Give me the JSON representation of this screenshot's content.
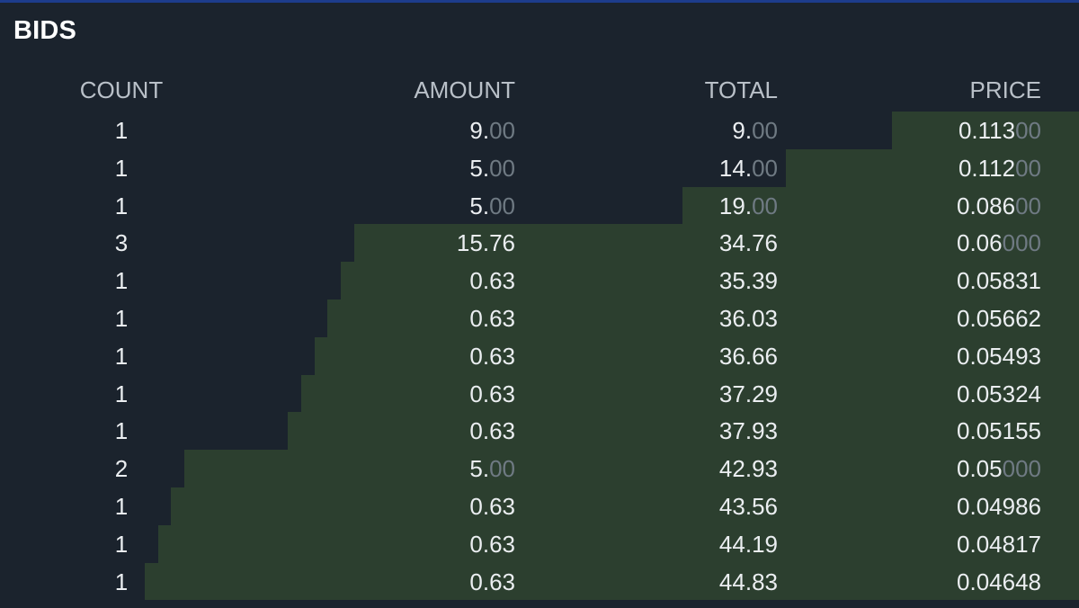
{
  "title": "BIDS",
  "columns": {
    "count": "COUNT",
    "amount": "AMOUNT",
    "total": "TOTAL",
    "price": "PRICE"
  },
  "colors": {
    "background": "#1b232d",
    "depth_fill": "#2c3f2f",
    "text": "#ebeef1",
    "dim_text": "#6f7a83",
    "header_text": "#b9c0c8"
  },
  "rows": [
    {
      "count": "1",
      "amount_main": "9.",
      "amount_dim": "00",
      "total_main": "9.",
      "total_dim": "00",
      "price_main": "0.113",
      "price_dim": "00",
      "depth": 0.1733
    },
    {
      "count": "1",
      "amount_main": "5.",
      "amount_dim": "00",
      "total_main": "14.",
      "total_dim": "00",
      "price_main": "0.112",
      "price_dim": "00",
      "depth": 0.2717
    },
    {
      "count": "1",
      "amount_main": "5.",
      "amount_dim": "00",
      "total_main": "19.",
      "total_dim": "00",
      "price_main": "0.086",
      "price_dim": "00",
      "depth": 0.3675
    },
    {
      "count": "3",
      "amount_main": "15.76",
      "amount_dim": "",
      "total_main": "34.76",
      "total_dim": "",
      "price_main": "0.06",
      "price_dim": "000",
      "depth": 0.6717
    },
    {
      "count": "1",
      "amount_main": "0.63",
      "amount_dim": "",
      "total_main": "35.39",
      "total_dim": "",
      "price_main": "0.05831",
      "price_dim": "",
      "depth": 0.6842
    },
    {
      "count": "1",
      "amount_main": "0.63",
      "amount_dim": "",
      "total_main": "36.03",
      "total_dim": "",
      "price_main": "0.05662",
      "price_dim": "",
      "depth": 0.6967
    },
    {
      "count": "1",
      "amount_main": "0.63",
      "amount_dim": "",
      "total_main": "36.66",
      "total_dim": "",
      "price_main": "0.05493",
      "price_dim": "",
      "depth": 0.7083
    },
    {
      "count": "1",
      "amount_main": "0.63",
      "amount_dim": "",
      "total_main": "37.29",
      "total_dim": "",
      "price_main": "0.05324",
      "price_dim": "",
      "depth": 0.7208
    },
    {
      "count": "1",
      "amount_main": "0.63",
      "amount_dim": "",
      "total_main": "37.93",
      "total_dim": "",
      "price_main": "0.05155",
      "price_dim": "",
      "depth": 0.7333
    },
    {
      "count": "2",
      "amount_main": "5.",
      "amount_dim": "00",
      "total_main": "42.93",
      "total_dim": "",
      "price_main": "0.05",
      "price_dim": "000",
      "depth": 0.8292
    },
    {
      "count": "1",
      "amount_main": "0.63",
      "amount_dim": "",
      "total_main": "43.56",
      "total_dim": "",
      "price_main": "0.04986",
      "price_dim": "",
      "depth": 0.8417
    },
    {
      "count": "1",
      "amount_main": "0.63",
      "amount_dim": "",
      "total_main": "44.19",
      "total_dim": "",
      "price_main": "0.04817",
      "price_dim": "",
      "depth": 0.8533
    },
    {
      "count": "1",
      "amount_main": "0.63",
      "amount_dim": "",
      "total_main": "44.83",
      "total_dim": "",
      "price_main": "0.04648",
      "price_dim": "",
      "depth": 0.8658
    }
  ]
}
